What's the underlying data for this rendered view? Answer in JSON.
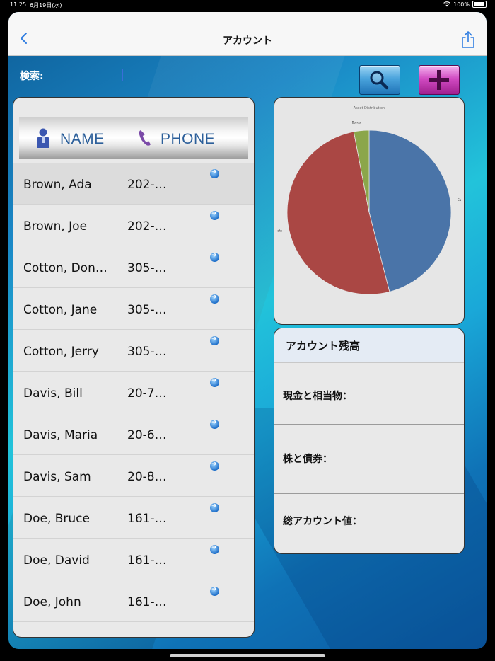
{
  "status_bar": {
    "time": "11:25",
    "date": "6月19日(水)",
    "battery": "100%"
  },
  "nav": {
    "title": "アカウント"
  },
  "search": {
    "label": "検索:",
    "value": "",
    "placeholder": ""
  },
  "list": {
    "header_name": "NAME",
    "header_phone": "PHONE",
    "rows": [
      {
        "name": "Brown, Ada",
        "phone": "202-…"
      },
      {
        "name": "Brown, Joe",
        "phone": "202-…"
      },
      {
        "name": "Cotton, Don…",
        "phone": "305-…"
      },
      {
        "name": "Cotton, Jane",
        "phone": "305-…"
      },
      {
        "name": "Cotton, Jerry",
        "phone": "305-…"
      },
      {
        "name": "Davis, Bill",
        "phone": "20-7…"
      },
      {
        "name": "Davis, Maria",
        "phone": "20-6…"
      },
      {
        "name": "Davis, Sam",
        "phone": "20-8…"
      },
      {
        "name": "Doe, Bruce",
        "phone": "161-…"
      },
      {
        "name": "Doe, David",
        "phone": "161-…"
      },
      {
        "name": "Doe, John",
        "phone": "161-…"
      }
    ]
  },
  "chart_data": {
    "type": "pie",
    "title": "Asset Distribution",
    "slices": [
      {
        "label": "Ca",
        "value": 46,
        "color": "#4a74a8"
      },
      {
        "label": "sks",
        "value": 51,
        "color": "#aa4744"
      },
      {
        "label": "Bonds",
        "value": 3,
        "color": "#8ba64a"
      }
    ]
  },
  "balance": {
    "title": "アカウント残高",
    "cash_label": "現金と相当物：",
    "stocks_label": "株と債券：",
    "total_label": "総アカウント値："
  },
  "colors": {
    "search_button": "#2f8fd0",
    "add_button": "#c13ab3",
    "header_text": "#2c5f9a"
  }
}
